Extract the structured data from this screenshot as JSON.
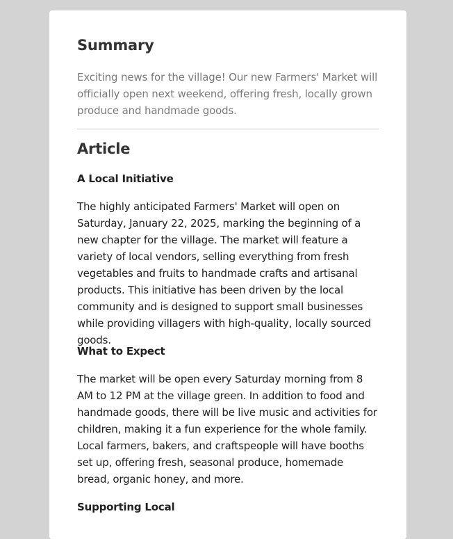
{
  "summary": {
    "heading": "Summary",
    "text": "Exciting news for the village! Our new Farmers' Market will officially open next weekend, offering fresh, locally grown produce and handmade goods."
  },
  "article": {
    "heading": "Article",
    "sections": [
      {
        "heading": "A Local Initiative",
        "text": "The highly anticipated Farmers' Market will open on Saturday, January 22, 2025, marking the beginning of a new chapter for the village. The market will feature a variety of local vendors, selling everything from fresh vegetables and fruits to handmade crafts and artisanal products. This initiative has been driven by the local community and is designed to support small businesses while providing villagers with high-quality, locally sourced goods."
      },
      {
        "heading": "What to Expect",
        "text": "The market will be open every Saturday morning from 8 AM to 12 PM at the village green. In addition to food and handmade goods, there will be live music and activities for children, making it a fun experience for the whole family. Local farmers, bakers, and craftspeople will have booths set up, offering fresh, seasonal produce, homemade bread, organic honey, and more."
      },
      {
        "heading": "Supporting Local",
        "text": ""
      }
    ]
  }
}
